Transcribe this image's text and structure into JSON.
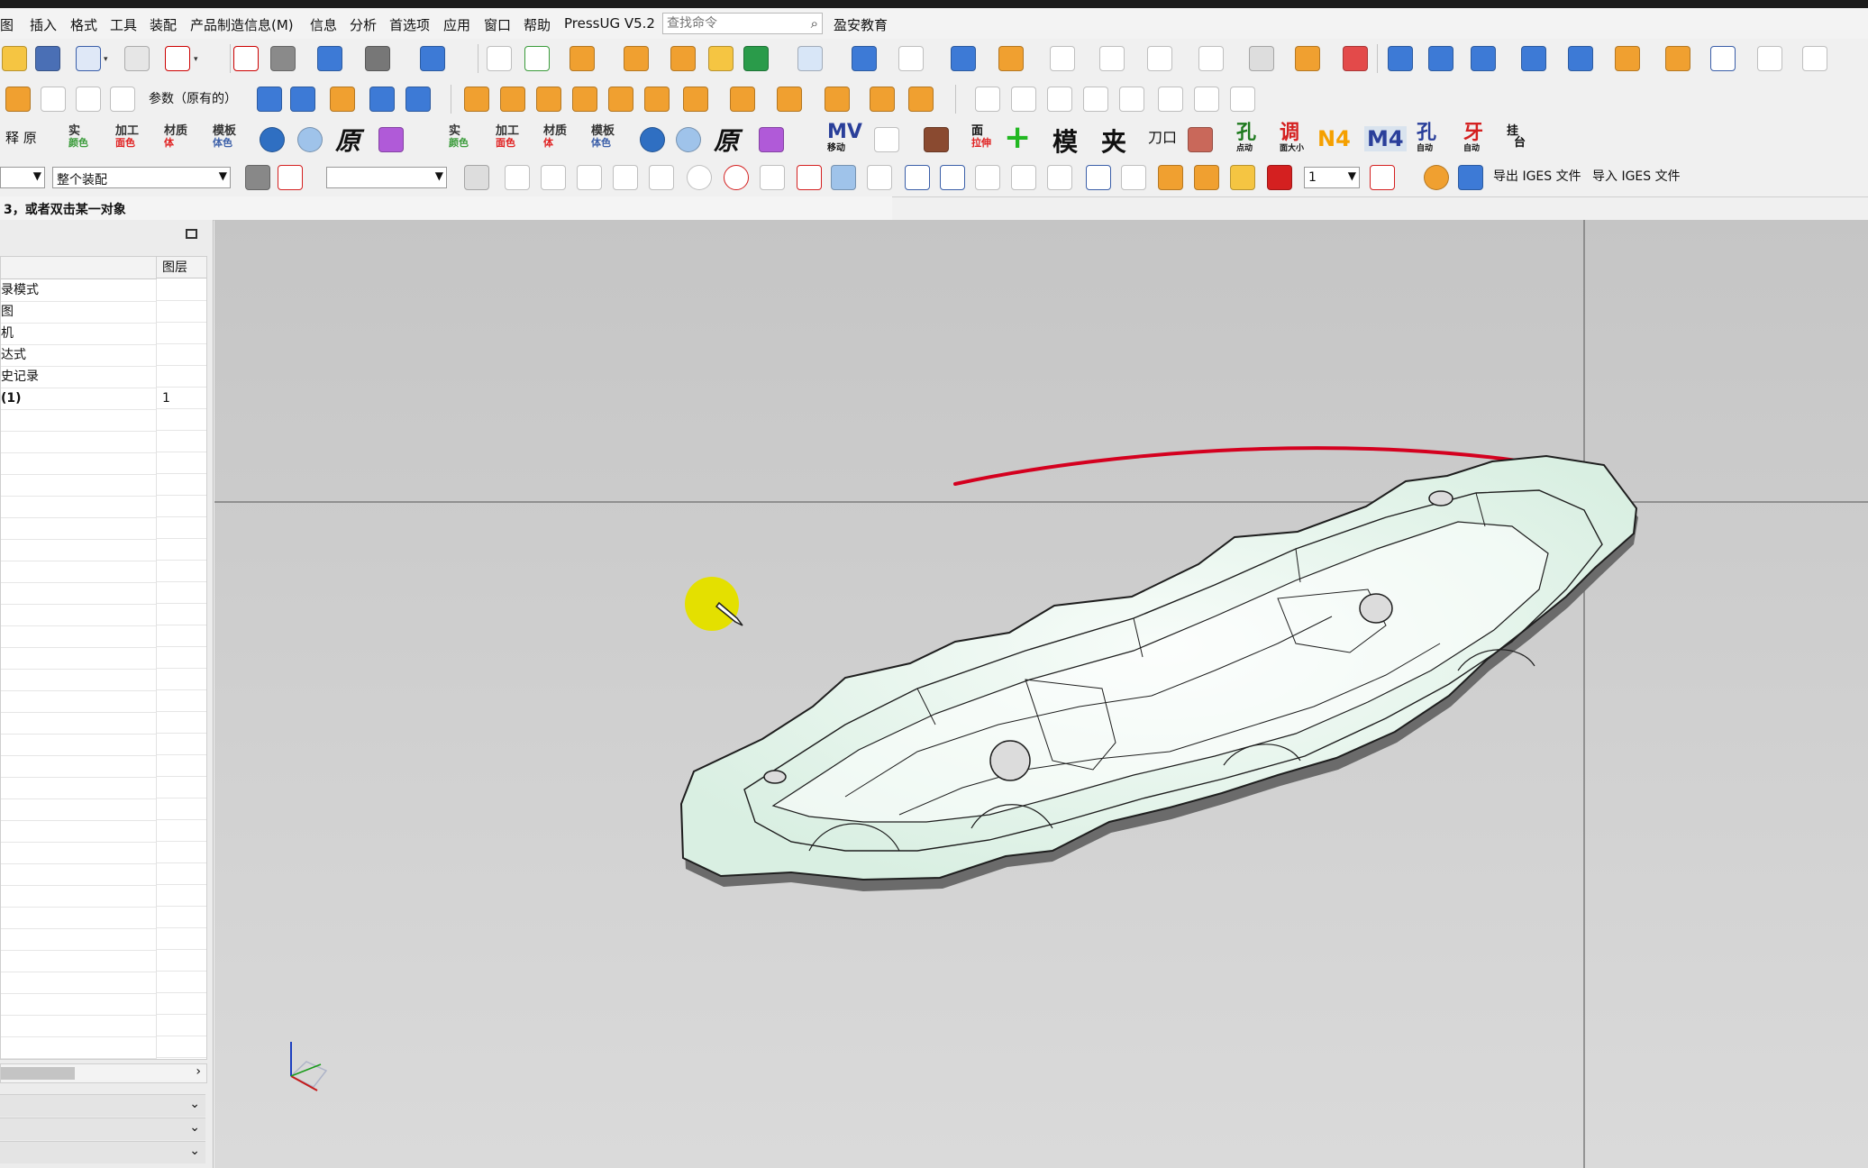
{
  "menubar": {
    "items": [
      "图",
      "插入",
      "格式",
      "工具",
      "装配",
      "产品制造信息(M)",
      "信息",
      "分析",
      "首选项",
      "应用",
      "窗口",
      "帮助",
      "PressUG V5.2"
    ],
    "search_placeholder": "查找命令",
    "brand": "盈安教育"
  },
  "toolbar2": {
    "param_label": "参数（原有的）"
  },
  "toolbar3": {
    "left_label": "释 原",
    "group1": [
      {
        "top": "实",
        "bot": "颜色"
      },
      {
        "top": "加工",
        "bot": "面色"
      },
      {
        "top": "材质",
        "bot": "体"
      },
      {
        "top": "模板",
        "bot": "体色"
      }
    ],
    "group2": [
      {
        "top": "实",
        "bot": "颜色"
      },
      {
        "top": "加工",
        "bot": "面色"
      },
      {
        "top": "材质",
        "bot": "体"
      },
      {
        "top": "模板",
        "bot": "体色"
      }
    ],
    "yuan": "原",
    "mv": "MV",
    "mv_sub": "移动",
    "mian_top": "面",
    "mian_bot": "拉伸",
    "mo": "模",
    "jia": "夹",
    "daokou": "刀口",
    "kong_top": "孔",
    "kong_bot": "点动",
    "tiao_top": "调",
    "tiao_bot": "面大小",
    "n4": "N4",
    "m4": "M4",
    "kong2_top": "孔",
    "kong2_bot": "自动",
    "ya_top": "牙",
    "ya_bot": "自动",
    "gua_top": "挂",
    "gua_bot": "台"
  },
  "toolbar4": {
    "assembly_select": "整个装配",
    "layer_value": "1",
    "export_iges": "导出 IGES 文件",
    "import_iges": "导入 IGES 文件"
  },
  "status": {
    "prompt": "3，或者双击某一对象"
  },
  "navigator": {
    "col_layer": "图层",
    "rows": [
      {
        "name": "录模式",
        "layer": ""
      },
      {
        "name": "图",
        "layer": ""
      },
      {
        "name": "机",
        "layer": ""
      },
      {
        "name": "达式",
        "layer": ""
      },
      {
        "name": "史记录",
        "layer": ""
      },
      {
        "name": "(1)",
        "layer": "1"
      }
    ]
  },
  "colors": {
    "annotation_stroke": "#d4001f",
    "cursor_highlight": "#e4e000",
    "part_fill": "#eaf6ef",
    "part_edge": "#1e1e1e",
    "background": "#cfcfcf"
  },
  "icons": [
    "open-icon",
    "save-icon",
    "undo-icon",
    "redo-icon",
    "fit-view-icon",
    "shaded-icon",
    "cube-icon",
    "wcs-icon"
  ]
}
